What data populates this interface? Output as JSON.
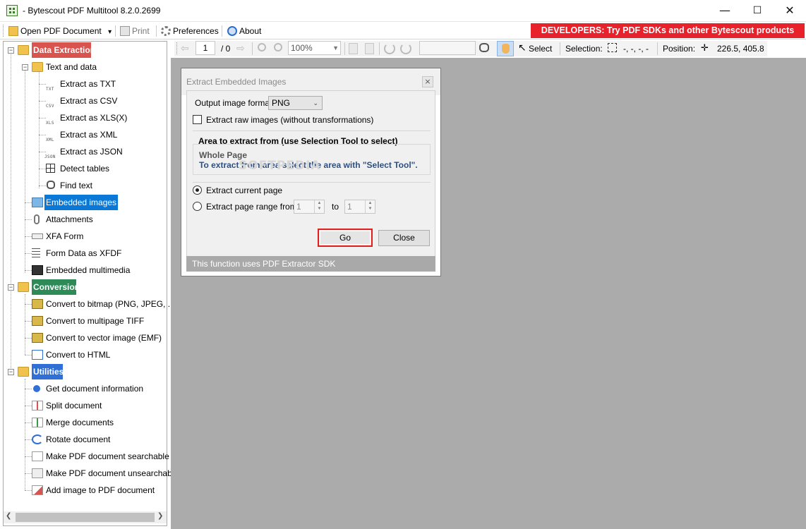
{
  "window": {
    "title": "- Bytescout PDF Multitool 8.2.0.2699",
    "min_glyph": "—",
    "max_glyph": "☐",
    "close_glyph": "✕"
  },
  "menu": {
    "open_label": "Open PDF Document",
    "print_label": "Print",
    "preferences_label": "Preferences",
    "about_label": "About",
    "dropdown_glyph": "▾"
  },
  "banner": {
    "text": "DEVELOPERS: Try PDF SDKs and other Bytescout products",
    "color": "#e8212b"
  },
  "toolbar": {
    "page_value": "1",
    "page_total": "/ 0",
    "zoom_value": "100%",
    "select_label": "Select",
    "selection_label": "Selection:",
    "selection_value": "-, -, -, -",
    "position_label": "Position:",
    "position_value": "226.5, 405.8"
  },
  "sidebar": {
    "categories": [
      {
        "label": "Data Extraction",
        "color": "#d9534f"
      },
      {
        "label": "Conversion",
        "color": "#2e8b57"
      },
      {
        "label": "Utilities",
        "color": "#2f6fd6"
      }
    ],
    "text_and_data": "Text and data",
    "text_items": [
      {
        "tag": "TXT",
        "label": "Extract as TXT"
      },
      {
        "tag": "CSV",
        "label": "Extract as CSV"
      },
      {
        "tag": "XLS",
        "label": "Extract as XLS(X)"
      },
      {
        "tag": "XML",
        "label": "Extract as XML"
      },
      {
        "tag": "JSON",
        "label": "Extract as JSON"
      },
      {
        "tag": "",
        "label": "Detect tables"
      },
      {
        "tag": "",
        "label": "Find text"
      }
    ],
    "extraction_items": [
      {
        "label": "Embedded images",
        "icon": "images-icon"
      },
      {
        "label": "Attachments",
        "icon": "paperclip-icon"
      },
      {
        "label": "XFA Form",
        "icon": "xfa-icon"
      },
      {
        "label": "Form Data as XFDF",
        "icon": "form-data-icon"
      },
      {
        "label": "Embedded multimedia",
        "icon": "film-icon"
      }
    ],
    "conversion_items": [
      {
        "label": "Convert to bitmap (PNG, JPEG, ...)"
      },
      {
        "label": "Convert to multipage TIFF"
      },
      {
        "label": "Convert to vector image (EMF)"
      },
      {
        "label": "Convert to HTML"
      }
    ],
    "utility_items": [
      {
        "label": "Get document information"
      },
      {
        "label": "Split document"
      },
      {
        "label": "Merge documents"
      },
      {
        "label": "Rotate document"
      },
      {
        "label": "Make PDF document searchable"
      },
      {
        "label": "Make PDF document unsearchable"
      },
      {
        "label": "Add image to PDF document"
      }
    ]
  },
  "dialog": {
    "title": "Extract Embedded Images",
    "close_glyph": "×",
    "format_label": "Output image format",
    "format_value": "PNG",
    "raw_images_label": "Extract raw images (without transformations)",
    "area_heading": "Area to extract from (use Selection Tool to select)",
    "area_value": "Whole Page",
    "area_hint": "To extract from area select the area with \"Select Tool\".",
    "current_page_label": "Extract current page",
    "range_label": "Extract page range from",
    "range_from": "1",
    "range_to_label": "to",
    "range_to": "1",
    "go_label": "Go",
    "close_label": "Close",
    "footer": "This function uses PDF Extractor SDK"
  },
  "watermark": "SOFTPEDIA"
}
